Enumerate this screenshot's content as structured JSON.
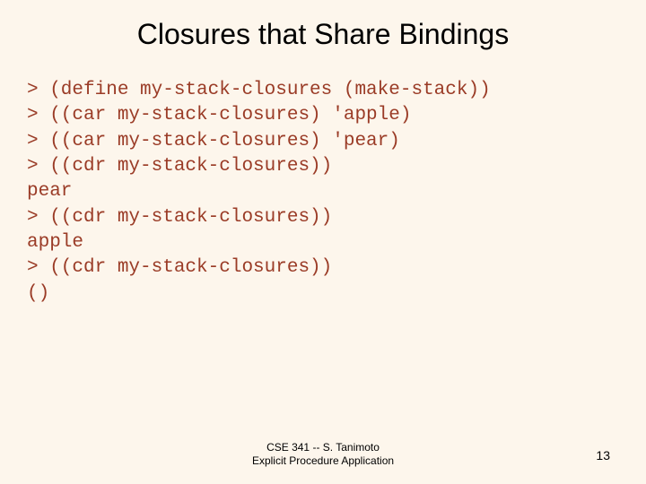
{
  "title": "Closures that Share Bindings",
  "code": "> (define my-stack-closures (make-stack))\n> ((car my-stack-closures) 'apple)\n> ((car my-stack-closures) 'pear)\n> ((cdr my-stack-closures))\npear\n> ((cdr my-stack-closures))\napple\n> ((cdr my-stack-closures))\n()",
  "footer": {
    "line1": "CSE 341 -- S. Tanimoto",
    "line2": "Explicit Procedure Application"
  },
  "page_number": "13"
}
